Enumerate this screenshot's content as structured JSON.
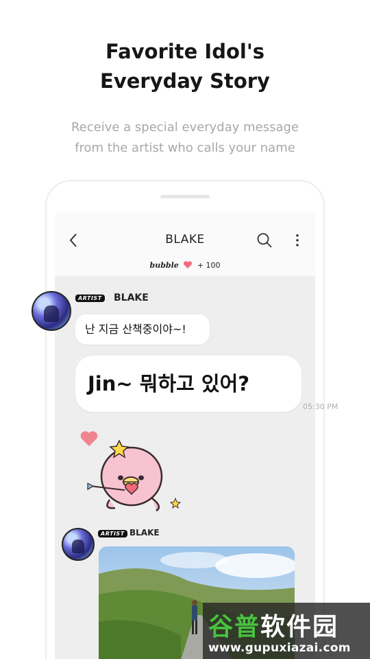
{
  "headline": {
    "line1": "Favorite Idol's",
    "line2": "Everyday Story",
    "subtitle_line1": "Receive a special everyday message",
    "subtitle_line2": "from the artist who calls your name",
    "highlight_color": "#ffe54c"
  },
  "chat": {
    "title": "BLAKE",
    "bubble_label": "bubble",
    "bubble_count": "+ 100",
    "icons": [
      "back-chevron-icon",
      "search-icon",
      "more-vertical-icon",
      "heart-icon"
    ],
    "messages": [
      {
        "artist_tag": "ARTIST",
        "sender": "BLAKE",
        "texts": [
          "난 지금 산책중이야~!",
          "Jin~ 뭐하고 있어?"
        ],
        "time": "05:30 PM"
      },
      {
        "artist_tag": "ARTIST",
        "sender": "BLAKE"
      }
    ]
  },
  "watermark": {
    "cn_part1": "谷普",
    "cn_part2": "软件园",
    "url": "www.gupuxiazai.com"
  }
}
